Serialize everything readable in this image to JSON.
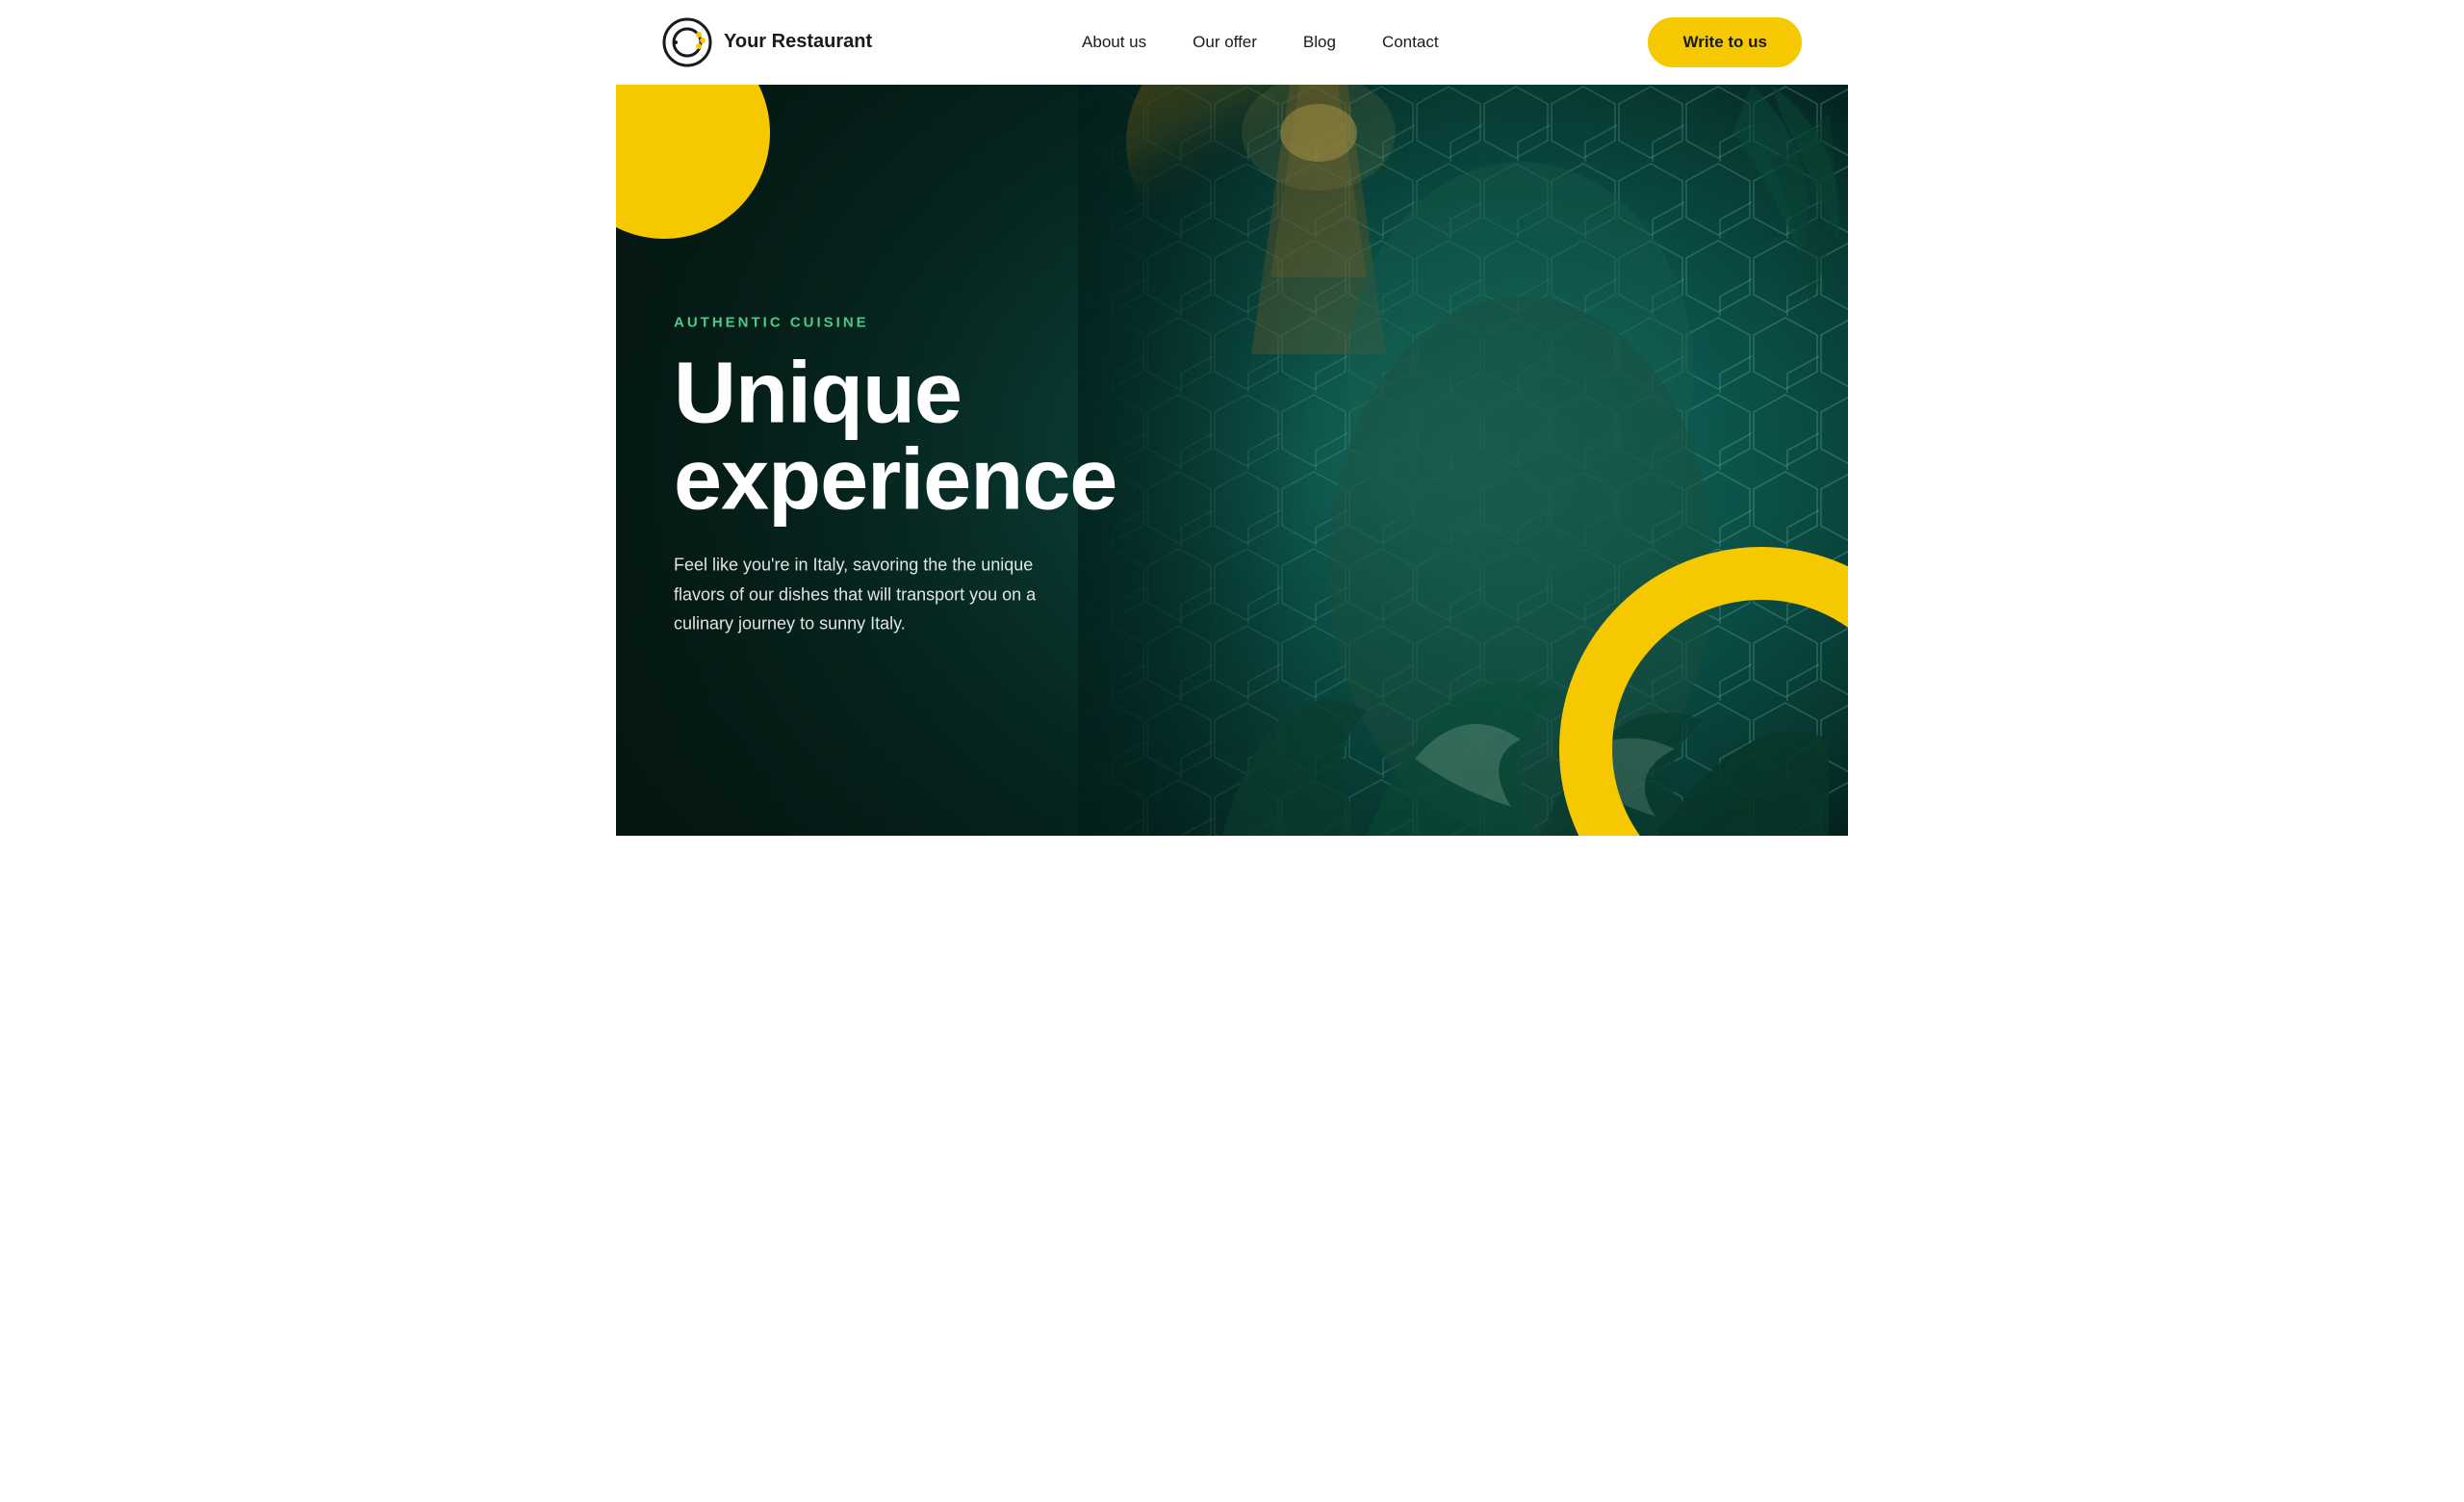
{
  "nav": {
    "logo_text": "Your Restaurant",
    "links": [
      {
        "label": "About us",
        "href": "#"
      },
      {
        "label": "Our offer",
        "href": "#"
      },
      {
        "label": "Blog",
        "href": "#"
      },
      {
        "label": "Contact",
        "href": "#"
      }
    ],
    "cta_label": "Write to us"
  },
  "hero": {
    "eyebrow": "AUTHENTIC CUISINE",
    "title_line1": "Unique",
    "title_line2": "experience",
    "description": "Feel like you're in Italy, savoring the the unique flavors of our dishes that will transport you on a culinary journey to sunny Italy.",
    "accent_color": "#f5c800",
    "eyebrow_color": "#4fc88a"
  }
}
